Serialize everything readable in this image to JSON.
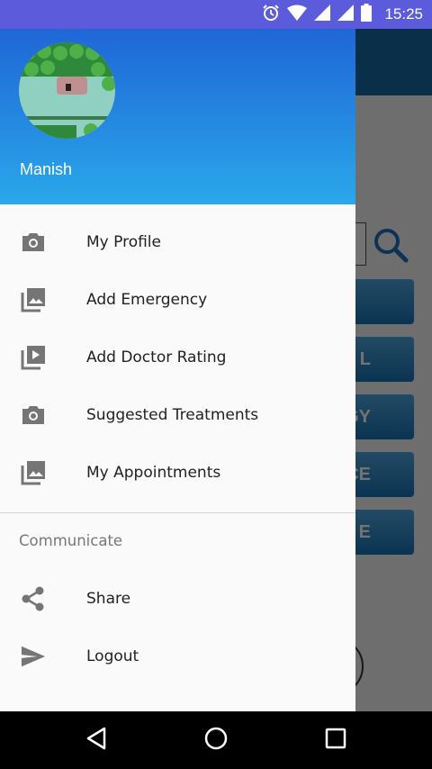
{
  "status_bar": {
    "time": "15:25",
    "icons": [
      "alarm-icon",
      "wifi-icon",
      "signal-icon",
      "signal-icon",
      "battery-icon"
    ]
  },
  "drawer": {
    "header": {
      "user_name": "Manish",
      "avatar": "pixel-art-avatar"
    },
    "items": [
      {
        "label": "My Profile",
        "icon": "camera-icon"
      },
      {
        "label": "Add Emergency",
        "icon": "gallery-icon"
      },
      {
        "label": "Add Doctor Rating",
        "icon": "video-library-icon"
      },
      {
        "label": "Suggested Treatments",
        "icon": "camera-icon"
      },
      {
        "label": "My Appointments",
        "icon": "gallery-icon"
      }
    ],
    "section_title": "Communicate",
    "section_items": [
      {
        "label": "Share",
        "icon": "share-icon"
      },
      {
        "label": "Logout",
        "icon": "send-icon"
      }
    ]
  },
  "background": {
    "buttons": [
      "",
      "L",
      "GY",
      "CE",
      "E"
    ]
  },
  "colors": {
    "status_bar": "#5b5bdb",
    "drawer_header_top": "#1f66d6",
    "drawer_header_bottom": "#2aa8ea",
    "icon_gray": "#757575"
  }
}
